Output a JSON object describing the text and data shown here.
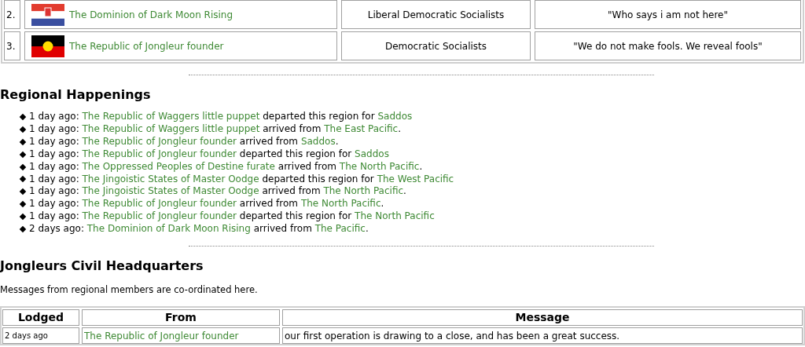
{
  "nations_table": {
    "rows": [
      {
        "rank": "2.",
        "flag": {
          "kind": "croatia"
        },
        "name": "The Dominion of Dark Moon Rising",
        "government": "Liberal Democratic Socialists",
        "motto": "\"Who says i am not here\""
      },
      {
        "rank": "3.",
        "flag": {
          "kind": "aboriginal"
        },
        "name": "The Republic of Jongleur founder",
        "government": "Democratic Socialists",
        "motto": "\"We do not make fools. We reveal fools\""
      }
    ]
  },
  "happenings": {
    "title": "Regional Happenings",
    "items": [
      {
        "time": "1 day ago:",
        "nation": "The Republic of Waggers little puppet",
        "action": "departed this region for",
        "place": "Saddos"
      },
      {
        "time": "1 day ago:",
        "nation": "The Republic of Waggers little puppet",
        "action": "arrived from",
        "place": "The East Pacific",
        "end": "."
      },
      {
        "time": "1 day ago:",
        "nation": "The Republic of Jongleur founder",
        "action": "arrived from",
        "place": "Saddos",
        "end": "."
      },
      {
        "time": "1 day ago:",
        "nation": "The Republic of Jongleur founder",
        "action": "departed this region for",
        "place": "Saddos"
      },
      {
        "time": "1 day ago:",
        "nation": "The Oppressed Peoples of Destine furate",
        "action": "arrived from",
        "place": "The North Pacific",
        "end": "."
      },
      {
        "time": "1 day ago:",
        "nation": "The Jingoistic States of Master Oodge",
        "action": "departed this region for",
        "place": "The West Pacific"
      },
      {
        "time": "1 day ago:",
        "nation": "The Jingoistic States of Master Oodge",
        "action": "arrived from",
        "place": "The North Pacific",
        "end": "."
      },
      {
        "time": "1 day ago:",
        "nation": "The Republic of Jongleur founder",
        "action": "arrived from",
        "place": "The North Pacific",
        "end": "."
      },
      {
        "time": "1 day ago:",
        "nation": "The Republic of Jongleur founder",
        "action": "departed this region for",
        "place": "The North Pacific"
      },
      {
        "time": "2 days ago:",
        "nation": "The Dominion of Dark Moon Rising",
        "action": "arrived from",
        "place": "The Pacific",
        "end": "."
      }
    ]
  },
  "headquarters": {
    "title": "Jongleurs Civil Headquarters",
    "description": "Messages from regional members are co-ordinated here.",
    "columns": [
      "Lodged",
      "From",
      "Message"
    ],
    "rows": [
      {
        "lodged": "2 days ago",
        "from": "The Republic of Jongleur founder",
        "message": "our first operation is drawing to a close, and has been a great success."
      }
    ]
  }
}
